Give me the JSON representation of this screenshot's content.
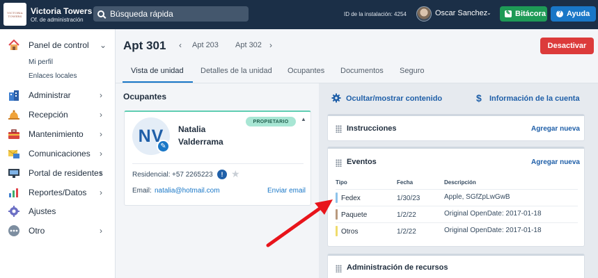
{
  "colors": {
    "topbar": "#1b2f47",
    "accent": "#1977c7",
    "success": "#1e9a56",
    "danger": "#dc3b3b",
    "badge": "#a8e6d4",
    "annotation_arrow": "#e8141b"
  },
  "topbar": {
    "logo_text": "VICTORIA TOWERS",
    "app_name": "Victoria Towers",
    "app_subtitle": "Of. de administración",
    "search_placeholder": "Búsqueda rápida",
    "installation_id": "ID de la instalación: 4254",
    "user_name": "Oscar Sanchez",
    "bitacora_label": "Bitácora",
    "ayuda_label": "Ayuda"
  },
  "sidebar": {
    "items": [
      {
        "label": "Panel de control",
        "icon": "house-icon",
        "chevron": "⌄"
      },
      {
        "label": "Administrar",
        "icon": "buildings-icon",
        "chevron": "›"
      },
      {
        "label": "Recepción",
        "icon": "bell-icon",
        "chevron": "›"
      },
      {
        "label": "Mantenimiento",
        "icon": "toolbox-icon",
        "chevron": "›"
      },
      {
        "label": "Comunicaciones",
        "icon": "envelope-icon",
        "chevron": "›"
      },
      {
        "label": "Portal de residentes",
        "icon": "monitor-icon",
        "chevron": "›"
      },
      {
        "label": "Reportes/Datos",
        "icon": "chart-icon",
        "chevron": "›"
      },
      {
        "label": "Ajustes",
        "icon": "gear-icon",
        "chevron": ""
      },
      {
        "label": "Otro",
        "icon": "ellipsis-icon",
        "chevron": "›"
      }
    ],
    "subitems": [
      "Mi perfil",
      "Enlaces locales"
    ]
  },
  "header": {
    "title": "Apt 301",
    "prev_unit": "Apt 203",
    "next_unit": "Apt 302",
    "deactivate_label": "Desactivar"
  },
  "tabs": [
    {
      "label": "Vista de unidad"
    },
    {
      "label": "Detalles de la unidad"
    },
    {
      "label": "Ocupantes"
    },
    {
      "label": "Documentos"
    },
    {
      "label": "Seguro"
    }
  ],
  "occupants": {
    "section_title": "Ocupantes",
    "initials": "NV",
    "first_name": "Natalia",
    "last_name": "Valderrama",
    "role_badge": "PROPIETARIO",
    "residential_label": "Residencial:",
    "phone": "+57 2265223",
    "email_label": "Email:",
    "email": "natalia@hotmail.com",
    "send_email_label": "Enviar email"
  },
  "panel": {
    "toggle_content_label": "Ocultar/mostrar contenido",
    "account_info_label": "Información de la cuenta"
  },
  "cards": {
    "instructions": {
      "title": "Instrucciones",
      "link": "Agregar nueva"
    },
    "events": {
      "title": "Eventos",
      "link": "Agregar nueva",
      "columns": [
        "Tipo",
        "Fecha",
        "Descripción"
      ],
      "rows": [
        {
          "type": "Fedex",
          "date": "1/30/23",
          "description": "Apple, SGfZpLwGwB",
          "color": "#8ec3ea"
        },
        {
          "type": "Paquete",
          "date": "1/2/22",
          "description": "Original OpenDate: 2017-01-18",
          "color": "#b99a7e"
        },
        {
          "type": "Otros",
          "date": "1/2/22",
          "description": "Original OpenDate: 2017-01-18",
          "color": "#efdb6c"
        }
      ]
    },
    "resources": {
      "title": "Administración de recursos"
    }
  }
}
